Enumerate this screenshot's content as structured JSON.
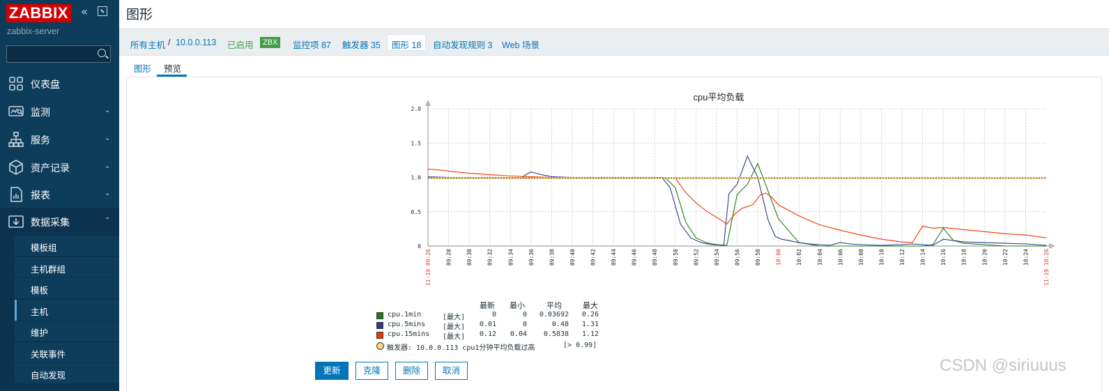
{
  "app": {
    "logo": "ZABBIX",
    "server_name": "zabbix-server",
    "collapse_glyph": "«"
  },
  "search": {
    "value": "",
    "placeholder": ""
  },
  "sidebar": {
    "items": [
      {
        "label": "仪表盘",
        "icon": "dashboard-icon",
        "expandable": false
      },
      {
        "label": "监测",
        "icon": "monitoring-icon",
        "expandable": true
      },
      {
        "label": "服务",
        "icon": "services-icon",
        "expandable": true
      },
      {
        "label": "资产记录",
        "icon": "inventory-icon",
        "expandable": true
      },
      {
        "label": "报表",
        "icon": "reports-icon",
        "expandable": true
      },
      {
        "label": "数据采集",
        "icon": "data-collection-icon",
        "expandable": true,
        "expanded": true
      }
    ],
    "submenu": [
      {
        "label": "模板组"
      },
      {
        "label": "主机群组"
      },
      {
        "label": "模板"
      },
      {
        "label": "主机",
        "active": true
      },
      {
        "label": "维护"
      },
      {
        "label": "关联事件"
      },
      {
        "label": "自动发现"
      }
    ]
  },
  "page": {
    "title": "图形"
  },
  "breadcrumb": {
    "all_hosts": "所有主机",
    "separator": "/",
    "host": "10.0.0.113",
    "status": "已启用",
    "zbx": "ZBX",
    "items": "监控项 87",
    "triggers": "触发器 35",
    "graphs": "图形 18",
    "discovery": "自动发现规则 3",
    "web": "Web 场景"
  },
  "tabs": {
    "graph": "图形",
    "preview": "预览"
  },
  "colors": {
    "sidebar_bg": "#0e3d5c",
    "accent": "#0275b8",
    "enabled": "#429e47",
    "series_1min": "#1a7c11",
    "series_5mins": "#2b3a8a",
    "series_15mins": "#f63100",
    "trigger": "#ffd87a"
  },
  "chart_data": {
    "type": "line",
    "title": "cpu平均负载",
    "ylim": [
      0,
      2.0
    ],
    "y_ticks": [
      "0",
      "0.5",
      "1.0",
      "1.5",
      "2.0"
    ],
    "x_start_label": "11-19 09:26",
    "x_end_label": "11-19 10:26",
    "x_tick_labels": [
      "09:28",
      "09:30",
      "09:32",
      "09:34",
      "09:36",
      "09:38",
      "09:40",
      "09:42",
      "09:44",
      "09:46",
      "09:48",
      "09:50",
      "09:52",
      "09:54",
      "09:56",
      "09:58",
      "10:00",
      "10:02",
      "10:04",
      "10:06",
      "10:08",
      "10:10",
      "10:12",
      "10:14",
      "10:16",
      "10:18",
      "10:20",
      "10:22",
      "10:24"
    ],
    "x_highlight": [
      "10:00"
    ],
    "trigger_threshold": 0.99,
    "series": [
      {
        "name": "cpu.1min",
        "color": "#1a7c11",
        "times": [
          "09:26",
          "09:28",
          "09:30",
          "09:32",
          "09:34",
          "09:35",
          "09:36",
          "09:38",
          "09:40",
          "09:45",
          "09:48",
          "09:49",
          "09:50",
          "09:51",
          "09:52",
          "09:53",
          "09:54",
          "09:55",
          "09:56",
          "09:57",
          "09:58",
          "09:59",
          "10:00",
          "10:02",
          "10:04",
          "10:06",
          "10:08",
          "10:10",
          "10:12",
          "10:13",
          "10:14",
          "10:15",
          "10:16",
          "10:17",
          "10:18",
          "10:20",
          "10:22",
          "10:24",
          "10:26"
        ],
        "values": [
          1.0,
          1.0,
          1.0,
          1.0,
          1.0,
          1.0,
          1.0,
          1.0,
          1.0,
          1.0,
          1.0,
          1.0,
          0.85,
          0.35,
          0.12,
          0.05,
          0.02,
          0.01,
          0.75,
          0.9,
          1.2,
          0.8,
          0.4,
          0.05,
          0.0,
          0.0,
          0.0,
          0.0,
          0.0,
          0.0,
          0.0,
          0.02,
          0.26,
          0.08,
          0.04,
          0.02,
          0.0,
          0.0,
          0.0
        ]
      },
      {
        "name": "cpu.5mins",
        "color": "#2b3a8a",
        "times": [
          "09:26",
          "09:28",
          "09:30",
          "09:32",
          "09:34",
          "09:35",
          "09:35.5",
          "09:36",
          "09:37",
          "09:38",
          "09:40",
          "09:45",
          "09:48",
          "09:48.7",
          "09:49.5",
          "09:50.5",
          "09:51.5",
          "09:52.5",
          "09:53.5",
          "09:54.7",
          "09:55.2",
          "09:56",
          "09:57",
          "09:58",
          "09:59",
          "09:59.7",
          "10:00.3",
          "10:01",
          "10:02",
          "10:03",
          "10:04",
          "10:05",
          "10:06",
          "10:07",
          "10:08",
          "10:10",
          "10:12",
          "10:13",
          "10:14",
          "10:15",
          "10:16",
          "10:17",
          "10:18",
          "10:20",
          "10:22",
          "10:24",
          "10:26"
        ],
        "values": [
          1.01,
          1.0,
          0.99,
          0.99,
          0.99,
          0.99,
          1.04,
          1.08,
          1.04,
          1.01,
          1.0,
          1.0,
          1.0,
          1.0,
          0.85,
          0.32,
          0.12,
          0.05,
          0.02,
          0.01,
          0.76,
          0.9,
          1.31,
          1.0,
          0.38,
          0.14,
          0.1,
          0.08,
          0.05,
          0.03,
          0.02,
          0.01,
          0.05,
          0.03,
          0.02,
          0.01,
          0.02,
          0.03,
          0.02,
          0.01,
          0.1,
          0.08,
          0.06,
          0.05,
          0.04,
          0.03,
          0.01
        ]
      },
      {
        "name": "cpu.15mins",
        "color": "#f63100",
        "times": [
          "09:26",
          "09:27",
          "09:28",
          "09:30",
          "09:32",
          "09:34",
          "09:36",
          "09:38",
          "09:40",
          "09:44",
          "09:48",
          "09:49",
          "09:50",
          "09:51",
          "09:52",
          "09:53",
          "09:54",
          "09:55",
          "09:55.8",
          "09:56.5",
          "09:57.5",
          "09:58.3",
          "09:58.8",
          "09:59.3",
          "10:00",
          "10:02",
          "10:04",
          "10:06",
          "10:08",
          "10:10",
          "10:12",
          "10:13",
          "10:14",
          "10:15",
          "10:16",
          "10:18",
          "10:20",
          "10:22",
          "10:24",
          "10:25.5",
          "10:26"
        ],
        "values": [
          1.12,
          1.11,
          1.09,
          1.06,
          1.04,
          1.02,
          1.01,
          1.0,
          1.0,
          0.99,
          0.99,
          0.99,
          0.99,
          0.78,
          0.63,
          0.51,
          0.42,
          0.32,
          0.47,
          0.55,
          0.6,
          0.75,
          0.77,
          0.72,
          0.6,
          0.44,
          0.31,
          0.23,
          0.16,
          0.1,
          0.06,
          0.05,
          0.29,
          0.26,
          0.27,
          0.24,
          0.21,
          0.18,
          0.16,
          0.13,
          0.12
        ]
      }
    ]
  },
  "legend": {
    "headers": {
      "last": "最新",
      "min": "最小",
      "avg": "平均",
      "max": "最大"
    },
    "rows": [
      {
        "name": "cpu.1min",
        "func": "[最大]",
        "last": "0",
        "min": "0",
        "avg": "0.03692",
        "max": "0.26",
        "color": "#1a7c11"
      },
      {
        "name": "cpu.5mins",
        "func": "[最大]",
        "last": "0.01",
        "min": "0",
        "avg": "0.48",
        "max": "1.31",
        "color": "#2b3a8a"
      },
      {
        "name": "cpu.15mins",
        "func": "[最大]",
        "last": "0.12",
        "min": "0.04",
        "avg": "0.5838",
        "max": "1.12",
        "color": "#f63100"
      }
    ],
    "trigger": "触发器: 10.0.0.113 cpu1分钟平均负载过高",
    "trigger_cond": "[> 0.99]"
  },
  "buttons": {
    "update": "更新",
    "clone": "克隆",
    "delete": "删除",
    "cancel": "取消"
  },
  "watermark": "CSDN @siriuuus"
}
